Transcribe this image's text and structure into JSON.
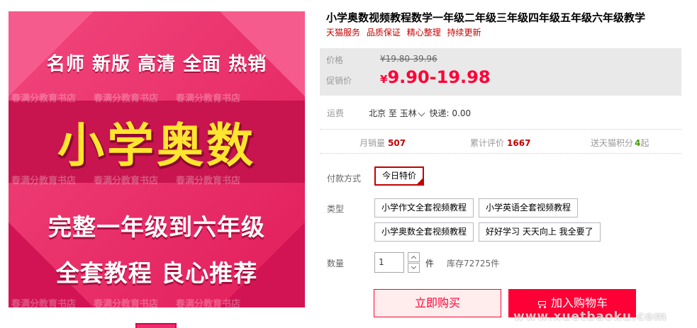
{
  "product": {
    "title": "小学奥数视频教程数学一年级二年级三年级四年级五年级六年级教学",
    "services": [
      "天猫服务",
      "品质保证",
      "精心整理",
      "持续更新"
    ]
  },
  "image": {
    "tagline": "名师 新版 高清 全面 热销",
    "big_title": "小学奥数",
    "line1": "完整一年级到六年级",
    "line2": "全套教程 良心推荐",
    "watermark": "春满分教育书店",
    "brand_color": "#ec2e6c",
    "title_color": "#ffe62e"
  },
  "price": {
    "label": "价格",
    "original": "¥19.80-39.96",
    "promo_label": "促销价",
    "currency": "¥",
    "promo": "9.90-19.98",
    "accent_color": "#ff0036"
  },
  "shipping": {
    "label": "运费",
    "from": "北京",
    "to_word": "至",
    "to": "玉林",
    "method": "快递: 0.00"
  },
  "stats": {
    "monthly_sales_label": "月销量",
    "monthly_sales": "507",
    "reviews_label": "累计评价",
    "reviews": "1667",
    "points_label": "送天猫积分",
    "points": "4",
    "points_suffix": "起"
  },
  "payment": {
    "label": "付款方式",
    "selected": "今日特价"
  },
  "type": {
    "label": "类型",
    "options": [
      "小学作文全套视频教程",
      "小学英语全套视频教程",
      "小学奥数全套视频教程",
      "好好学习 天天向上 我全要了"
    ]
  },
  "quantity": {
    "label": "数量",
    "value": "1",
    "unit": "件",
    "stock": "库存72725件"
  },
  "actions": {
    "buy_now": "立即购买",
    "add_to_cart": "加入购物车"
  },
  "site_watermark": "www.xuetbaoku.com"
}
